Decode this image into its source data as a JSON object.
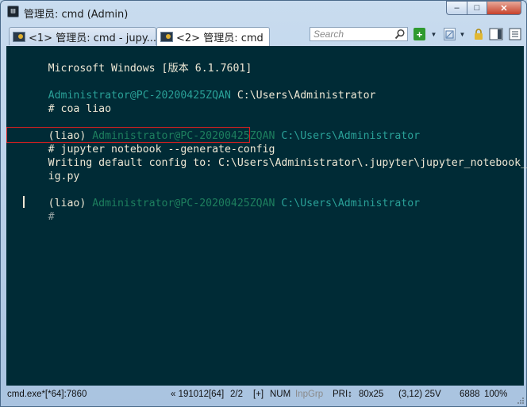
{
  "window": {
    "title": "管理员: cmd (Admin)",
    "buttons": {
      "minimize": "–",
      "maximize": "□",
      "close": "✕"
    }
  },
  "tabs": [
    {
      "label": "<1> 管理员: cmd - jupy..."
    },
    {
      "label": "<2> 管理员: cmd"
    }
  ],
  "toolbar": {
    "search_placeholder": "Search",
    "add_label": "+"
  },
  "console": {
    "lines": [
      {
        "text": "Microsoft Windows [版本 6.1.7601]"
      },
      {
        "user": "Administrator@PC-20200425ZQAN",
        "path": " C:\\Users\\Administrator"
      },
      {
        "prompt": "# coa liao"
      },
      {
        "env": "(liao) ",
        "user": "Administrator@PC-20200425ZQAN",
        "path": " C:\\Users\\Administrator"
      },
      {
        "prompt": "# jupyter notebook --generate-config"
      },
      {
        "text": "Writing default config to: C:\\Users\\Administrator\\.jupyter\\jupyter_notebook_conf"
      },
      {
        "text": "ig.py"
      },
      {
        "env": "(liao) ",
        "user": "Administrator@PC-20200425ZQAN",
        "path": " C:\\Users\\Administrator"
      },
      {
        "prompt": "# "
      }
    ]
  },
  "status": {
    "process": "cmd.exe*[*64]:7860",
    "build": "« 191012[64]",
    "tab_index": "2/2",
    "plus": "[+]",
    "num": "NUM",
    "inpgrp": "InpGrp",
    "pri": "PRI↕",
    "size": "80x25",
    "cursor_pos": "(3,12) 25V",
    "pid": "6888",
    "zoom": "100%"
  }
}
